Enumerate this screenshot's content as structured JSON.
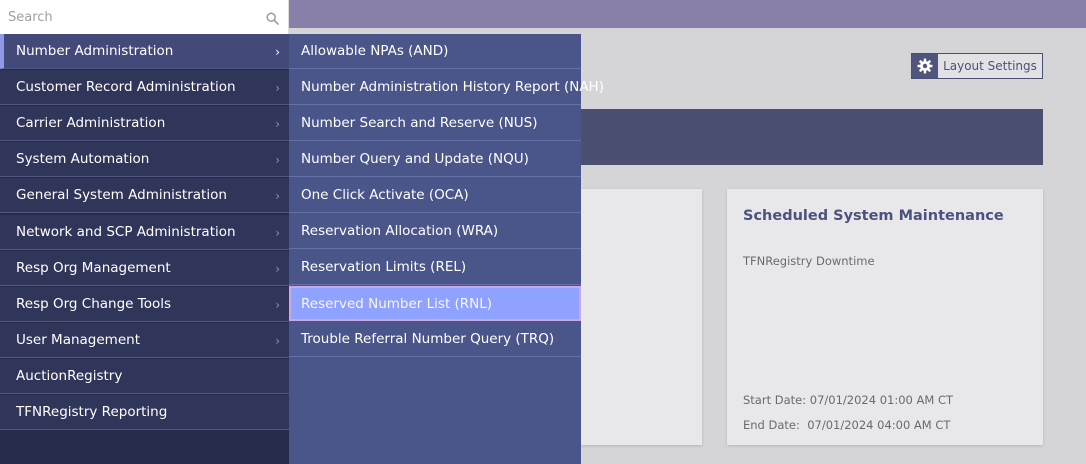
{
  "search": {
    "placeholder": "Search"
  },
  "background": {
    "layout_settings_label": "Layout Settings",
    "card": {
      "title": "Scheduled System Maintenance",
      "subtitle": "TFNRegistry Downtime",
      "start_label": "Start Date:",
      "start_value": "07/01/2024 01:00 AM CT",
      "end_label": "End Date:",
      "end_value": "07/01/2024 04:00 AM CT"
    }
  },
  "menu": {
    "items": [
      {
        "label": "Number Administration",
        "has_submenu": true,
        "active": true
      },
      {
        "label": "Customer Record Administration",
        "has_submenu": true
      },
      {
        "label": "Carrier Administration",
        "has_submenu": true
      },
      {
        "label": "System Automation",
        "has_submenu": true
      },
      {
        "label": "General System Administration",
        "has_submenu": true
      },
      {
        "label": "Network and SCP Administration",
        "has_submenu": true
      },
      {
        "label": "Resp Org Management",
        "has_submenu": true
      },
      {
        "label": "Resp Org Change Tools",
        "has_submenu": true
      },
      {
        "label": "User Management",
        "has_submenu": true
      },
      {
        "label": "AuctionRegistry",
        "has_submenu": false
      },
      {
        "label": "TFNRegistry Reporting",
        "has_submenu": false
      }
    ],
    "chevron": "›"
  },
  "submenu": {
    "items": [
      {
        "label": "Allowable NPAs (AND)"
      },
      {
        "label": "Number Administration History Report (NAH)"
      },
      {
        "label": "Number Search and Reserve (NUS)"
      },
      {
        "label": "Number Query and Update (NQU)"
      },
      {
        "label": "One Click Activate (OCA)"
      },
      {
        "label": "Reservation Allocation (WRA)"
      },
      {
        "label": "Reservation Limits (REL)"
      },
      {
        "label": "Reserved Number List (RNL)",
        "hovered": true
      },
      {
        "label": "Trouble Referral Number Query (TRQ)"
      }
    ]
  },
  "colors": {
    "menu_bg": "#30355a",
    "menu_active": "#434a79",
    "submenu_bg": "#4a5589",
    "submenu_hover": "#8fa2ff",
    "topbar": "#8a7fa8",
    "card_title": "#4c5280"
  },
  "icons": {
    "search": "search-icon",
    "settings": "gear-icon",
    "chevron": "chevron-right-icon"
  }
}
